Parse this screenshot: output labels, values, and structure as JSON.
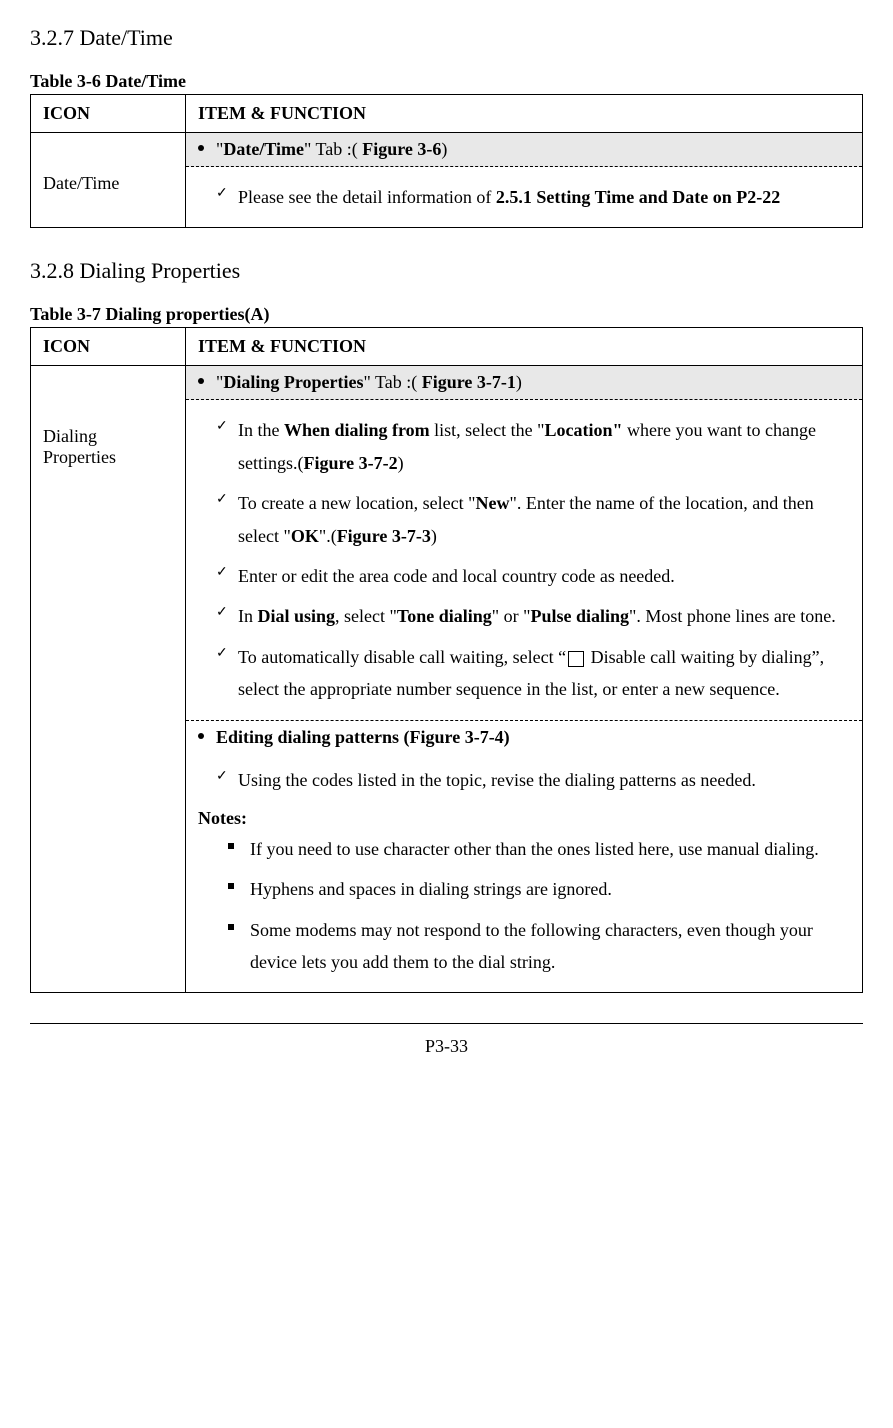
{
  "section1": {
    "heading": "3.2.7 Date/Time",
    "table_caption": "Table 3-6 Date/Time",
    "header_icon": "ICON",
    "header_item": "ITEM & FUNCTION",
    "row": {
      "icon_label": "Date/Time",
      "tab_prefix": "\"",
      "tab_name": "Date/Time",
      "tab_mid": "\" Tab",
      "tab_suffix": " :( ",
      "tab_fig": "Figure 3-6",
      "tab_close": ")",
      "item1_pre": "Please see the detail information of ",
      "item1_bold": "2.5.1 Setting Time and Date on P2-22"
    }
  },
  "section2": {
    "heading": "3.2.8 Dialing Properties",
    "table_caption": "Table 3-7 Dialing properties(A)",
    "header_icon": "ICON",
    "header_item": "ITEM & FUNCTION",
    "row": {
      "icon_label": "Dialing Properties",
      "tab_prefix": "\"",
      "tab_name": "Dialing Properties",
      "tab_mid": "\" Tab",
      "tab_suffix": " :( ",
      "tab_fig": "Figure 3-7-1",
      "tab_close": ")",
      "i1_a": "In the ",
      "i1_b": "When dialing from",
      "i1_c": " list, select the \"",
      "i1_d": "Location\"",
      "i1_e": " where you want to change settings.(",
      "i1_f": "Figure 3-7-2",
      "i1_g": ")",
      "i2_a": "To create a new location, select \"",
      "i2_b": "New",
      "i2_c": "\". Enter the name of the location, and then select \"",
      "i2_d": "OK",
      "i2_e": "\".(",
      "i2_f": "Figure 3-7-3",
      "i2_g": ")",
      "i3": "Enter or edit the area code and local country code as needed.",
      "i4_a": "In ",
      "i4_b": "Dial using",
      "i4_c": ", select \"",
      "i4_d": "Tone dialing",
      "i4_e": "\" or \"",
      "i4_f": "Pulse dialing",
      "i4_g": "\". Most phone lines are tone.",
      "i5_a": "To automatically disable call waiting, select “",
      "i5_b": " Disable call waiting by dialing”, select the appropriate number sequence in the list, or enter a new sequence.",
      "sub_header": "Editing dialing patterns (Figure 3-7-4)",
      "i6": "Using the codes listed in the topic, revise the dialing patterns as needed.",
      "notes_label": "Notes:",
      "n1": "If you need to use character other than the ones listed here, use manual dialing.",
      "n2": "Hyphens and spaces in dialing strings are ignored.",
      "n3": "Some modems may not respond to the following characters, even though your device lets you add them to the dial string."
    }
  },
  "footer": "P3-33"
}
